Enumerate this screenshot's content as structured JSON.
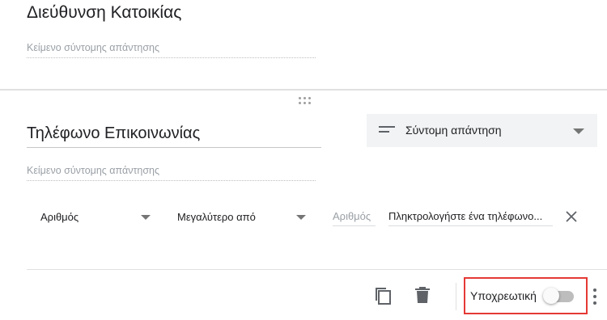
{
  "previous_question": {
    "title": "Διεύθυνση Κατοικίας",
    "answer_placeholder": "Κείμενο σύντομης απάντησης"
  },
  "question": {
    "title": "Τηλέφωνο Επικοινωνίας",
    "type_select": {
      "selected": "Σύντομη απάντηση",
      "icon": "short-text-icon"
    },
    "answer_placeholder": "Κείμενο σύντομης απάντησης"
  },
  "validation": {
    "category": "Αριθμός",
    "condition": "Μεγαλύτερο από",
    "number_placeholder": "Αριθμός",
    "error_text": "Πληκτρολογήστε ένα τηλέφωνο..."
  },
  "footer": {
    "required_label": "Υποχρεωτική",
    "required_on": false,
    "highlight_color": "#e53935"
  }
}
